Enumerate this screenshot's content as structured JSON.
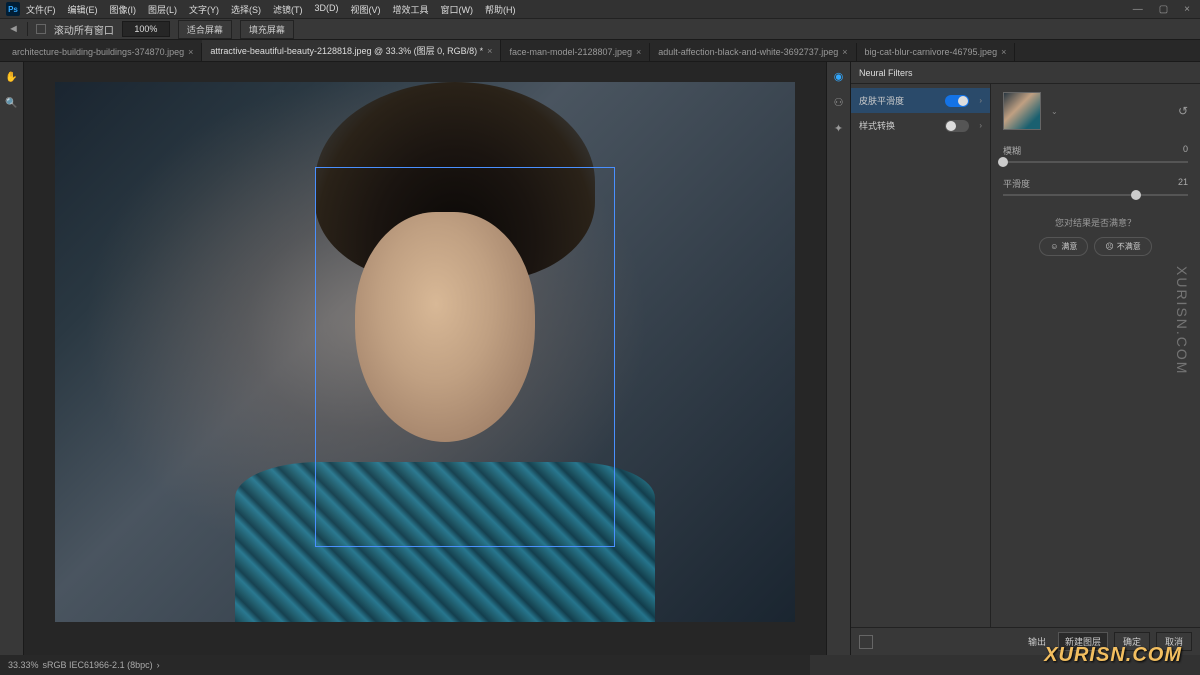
{
  "app": {
    "icon": "Ps"
  },
  "menu": [
    "文件(F)",
    "编辑(E)",
    "图像(I)",
    "图层(L)",
    "文字(Y)",
    "选择(S)",
    "滤镜(T)",
    "3D(D)",
    "视图(V)",
    "增效工具",
    "窗口(W)",
    "帮助(H)"
  ],
  "optbar": {
    "scroll_label": "滚动所有窗口",
    "zoom": "100%",
    "fit": "适合屏幕",
    "fill": "填充屏幕"
  },
  "tabs": [
    {
      "label": "architecture-building-buildings-374870.jpeg",
      "close": "×"
    },
    {
      "label": "attractive-beautiful-beauty-2128818.jpeg @ 33.3% (图层 0, RGB/8) *",
      "close": "×",
      "active": true
    },
    {
      "label": "face-man-model-2128807.jpeg",
      "close": "×"
    },
    {
      "label": "adult-affection-black-and-white-3692737.jpeg",
      "close": "×"
    },
    {
      "label": "big-cat-blur-carnivore-46795.jpeg",
      "close": "×"
    }
  ],
  "panel": {
    "title": "Neural Filters",
    "filters": [
      {
        "name": "皮肤平滑度",
        "on": true,
        "sel": true
      },
      {
        "name": "样式转换",
        "on": false,
        "sel": false
      }
    ],
    "sliders": [
      {
        "label": "模糊",
        "value": 0,
        "pos": 0
      },
      {
        "label": "平滑度",
        "value": 21,
        "pos": 72
      }
    ],
    "feedback": {
      "q": "您对结果是否满意？",
      "yes": "满意",
      "no": "不满意"
    },
    "output_label": "输出",
    "output_value": "新建图层",
    "ok": "确定",
    "cancel": "取消"
  },
  "status": {
    "zoom": "33.33%",
    "profile": "sRGB IEC61966-2.1 (8bpc)"
  },
  "watermark": "XURISN.COM",
  "watermark2": "XURISN.COM"
}
